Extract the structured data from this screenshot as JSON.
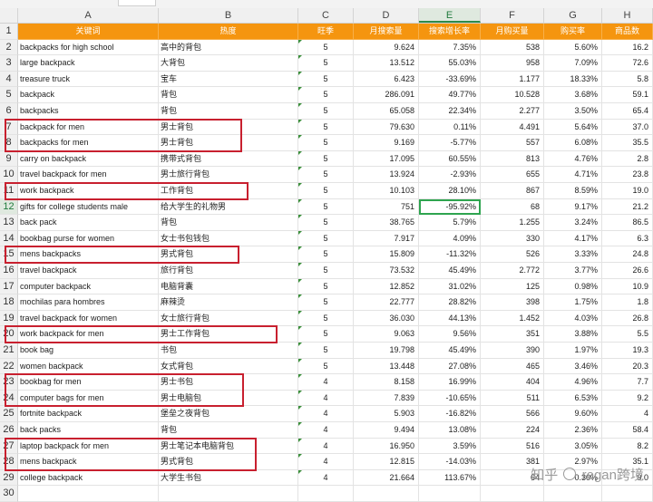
{
  "sheet": {
    "columns": [
      "A",
      "B",
      "C",
      "D",
      "E",
      "F",
      "G",
      "H"
    ],
    "active_column": "E",
    "active_row": 12,
    "header_row": {
      "row": 1,
      "cells": [
        "关键词",
        "热度",
        "旺季",
        "月搜索量",
        "搜索增长率",
        "月购买量",
        "购买率",
        "商品数"
      ]
    },
    "rows": [
      {
        "row": 2,
        "cells": [
          "backpacks for high school",
          "高中的背包",
          "5",
          "9.624",
          "7.35%",
          "538",
          "5.60%",
          "16.2"
        ]
      },
      {
        "row": 3,
        "cells": [
          "large backpack",
          "大背包",
          "5",
          "13.512",
          "55.03%",
          "958",
          "7.09%",
          "72.6"
        ]
      },
      {
        "row": 4,
        "cells": [
          "treasure truck",
          "宝车",
          "5",
          "6.423",
          "-33.69%",
          "1.177",
          "18.33%",
          "5.8"
        ]
      },
      {
        "row": 5,
        "cells": [
          "backpack",
          "背包",
          "5",
          "286.091",
          "49.77%",
          "10.528",
          "3.68%",
          "59.1"
        ]
      },
      {
        "row": 6,
        "cells": [
          "backpacks",
          "背包",
          "5",
          "65.058",
          "22.34%",
          "2.277",
          "3.50%",
          "65.4"
        ]
      },
      {
        "row": 7,
        "cells": [
          "backpack for men",
          "男士背包",
          "5",
          "79.630",
          "0.11%",
          "4.491",
          "5.64%",
          "37.0"
        ]
      },
      {
        "row": 8,
        "cells": [
          "backpacks for men",
          "男士背包",
          "5",
          "9.169",
          "-5.77%",
          "557",
          "6.08%",
          "35.5"
        ]
      },
      {
        "row": 9,
        "cells": [
          "carry on backpack",
          "携带式背包",
          "5",
          "17.095",
          "60.55%",
          "813",
          "4.76%",
          "2.8"
        ]
      },
      {
        "row": 10,
        "cells": [
          "travel backpack for men",
          "男士旅行背包",
          "5",
          "13.924",
          "-2.93%",
          "655",
          "4.71%",
          "23.8"
        ]
      },
      {
        "row": 11,
        "cells": [
          "work backpack",
          "工作背包",
          "5",
          "10.103",
          "28.10%",
          "867",
          "8.59%",
          "19.0"
        ]
      },
      {
        "row": 12,
        "cells": [
          "gifts for college students male",
          "给大学生的礼物男",
          "5",
          "751",
          "-95.92%",
          "68",
          "9.17%",
          "21.2"
        ]
      },
      {
        "row": 13,
        "cells": [
          "back pack",
          "背包",
          "5",
          "38.765",
          "5.79%",
          "1.255",
          "3.24%",
          "86.5"
        ]
      },
      {
        "row": 14,
        "cells": [
          "bookbag purse for women",
          "女士书包钱包",
          "5",
          "7.917",
          "4.09%",
          "330",
          "4.17%",
          "6.3"
        ]
      },
      {
        "row": 15,
        "cells": [
          "mens backpacks",
          "男式背包",
          "5",
          "15.809",
          "-11.32%",
          "526",
          "3.33%",
          "24.8"
        ]
      },
      {
        "row": 16,
        "cells": [
          "travel backpack",
          "旅行背包",
          "5",
          "73.532",
          "45.49%",
          "2.772",
          "3.77%",
          "26.6"
        ]
      },
      {
        "row": 17,
        "cells": [
          "computer backpack",
          "电脑背囊",
          "5",
          "12.852",
          "31.02%",
          "125",
          "0.98%",
          "10.9"
        ]
      },
      {
        "row": 18,
        "cells": [
          "mochilas para hombres",
          "麻辣烫",
          "5",
          "22.777",
          "28.82%",
          "398",
          "1.75%",
          "1.8"
        ]
      },
      {
        "row": 19,
        "cells": [
          "travel backpack for women",
          "女士旅行背包",
          "5",
          "36.030",
          "44.13%",
          "1.452",
          "4.03%",
          "26.8"
        ]
      },
      {
        "row": 20,
        "cells": [
          "work backpack for men",
          "男士工作背包",
          "5",
          "9.063",
          "9.56%",
          "351",
          "3.88%",
          "5.5"
        ]
      },
      {
        "row": 21,
        "cells": [
          "book bag",
          "书包",
          "5",
          "19.798",
          "45.49%",
          "390",
          "1.97%",
          "19.3"
        ]
      },
      {
        "row": 22,
        "cells": [
          "women backpack",
          "女式背包",
          "5",
          "13.448",
          "27.08%",
          "465",
          "3.46%",
          "20.3"
        ]
      },
      {
        "row": 23,
        "cells": [
          "bookbag for men",
          "男士书包",
          "4",
          "8.158",
          "16.99%",
          "404",
          "4.96%",
          "7.7"
        ]
      },
      {
        "row": 24,
        "cells": [
          "computer bags for men",
          "男士电脑包",
          "4",
          "7.839",
          "-10.65%",
          "511",
          "6.53%",
          "9.2"
        ]
      },
      {
        "row": 25,
        "cells": [
          "fortnite backpack",
          "堡垒之夜背包",
          "4",
          "5.903",
          "-16.82%",
          "566",
          "9.60%",
          "4"
        ]
      },
      {
        "row": 26,
        "cells": [
          "back packs",
          "背包",
          "4",
          "9.494",
          "13.08%",
          "224",
          "2.36%",
          "58.4"
        ]
      },
      {
        "row": 27,
        "cells": [
          "laptop backpack for men",
          "男士笔记本电脑背包",
          "4",
          "16.950",
          "3.59%",
          "516",
          "3.05%",
          "8.2"
        ]
      },
      {
        "row": 28,
        "cells": [
          "mens backpack",
          "男式背包",
          "4",
          "12.815",
          "-14.03%",
          "381",
          "2.97%",
          "35.1"
        ]
      },
      {
        "row": 29,
        "cells": [
          "college backpack",
          "大学生书包",
          "4",
          "21.664",
          "113.67%",
          "64",
          "0.30%",
          "9.0"
        ]
      },
      {
        "row": 30,
        "cells": [
          "",
          "",
          "",
          "",
          "",
          "",
          "",
          ""
        ]
      }
    ]
  },
  "highlights": [
    {
      "label": "backpack for men / backpacks for men"
    },
    {
      "label": "work backpack"
    },
    {
      "label": "mens backpacks"
    },
    {
      "label": "work backpack for men"
    },
    {
      "label": "bookbag for men / computer bags for men"
    },
    {
      "label": "laptop backpack for men / mens backpack"
    }
  ],
  "watermark": {
    "left": "知乎",
    "right": "regan跨境"
  },
  "colors": {
    "header_fill": "#f5950f",
    "highlight_border": "#c8202f",
    "selection": "#2ea44f"
  }
}
